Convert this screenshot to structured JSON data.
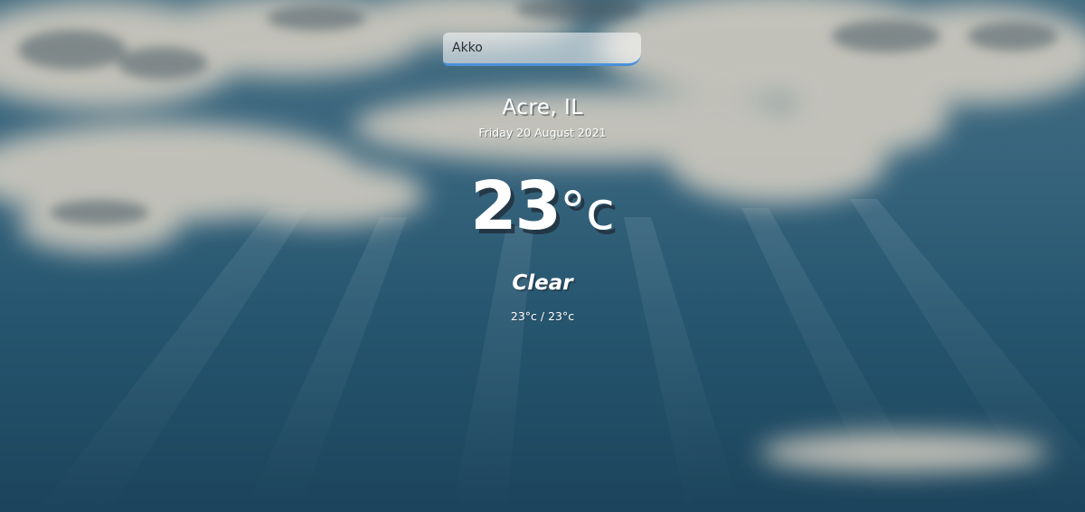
{
  "search": {
    "value": "Akko",
    "placeholder": ""
  },
  "location": {
    "name": "Acre, IL",
    "date": "Friday 20 August 2021"
  },
  "weather": {
    "temperature": "23",
    "unit": "°c",
    "condition": "Clear",
    "min_max": "23°c / 23°c"
  },
  "colors": {
    "search_underline": "#4a90d9",
    "background": "#2b5a72",
    "text": "#ffffff"
  },
  "background": {
    "image": "cloudy-sky-with-sun-rays"
  }
}
